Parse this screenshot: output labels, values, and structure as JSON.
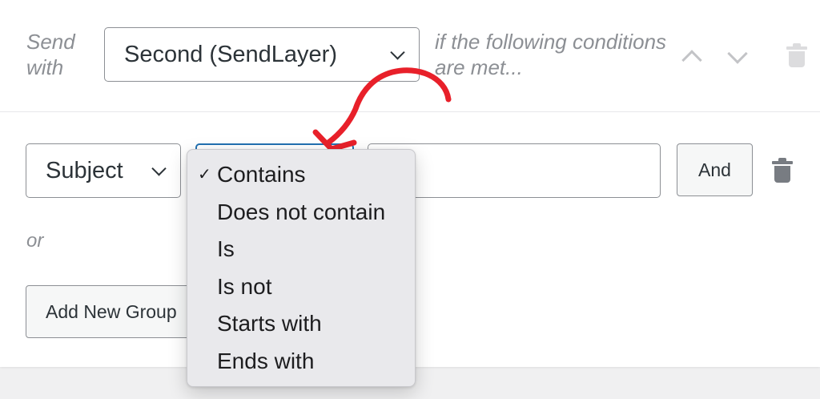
{
  "rule": {
    "send_label": "Send with",
    "provider_value": "Second (SendLayer)",
    "conditions_label": "if the following conditions are met..."
  },
  "condition": {
    "field_value": "Subject",
    "value_input": "",
    "and_label": "And"
  },
  "or_label": "or",
  "add_group_label": "Add New Group",
  "operator_menu": {
    "check_glyph": "✓",
    "options": [
      "Contains",
      "Does not contain",
      "Is",
      "Is not",
      "Starts with",
      "Ends with"
    ],
    "selected": "Contains"
  },
  "icons": {
    "chevron": "chevron-down-icon",
    "trash": "trash-icon",
    "move_up": "chevron-up-icon",
    "move_down": "chevron-down-icon",
    "annotation": "red-arrow-icon"
  },
  "colors": {
    "focus_border": "#2271b1",
    "annotation_red": "#e8202a",
    "menu_bg": "#e9e9ec"
  }
}
